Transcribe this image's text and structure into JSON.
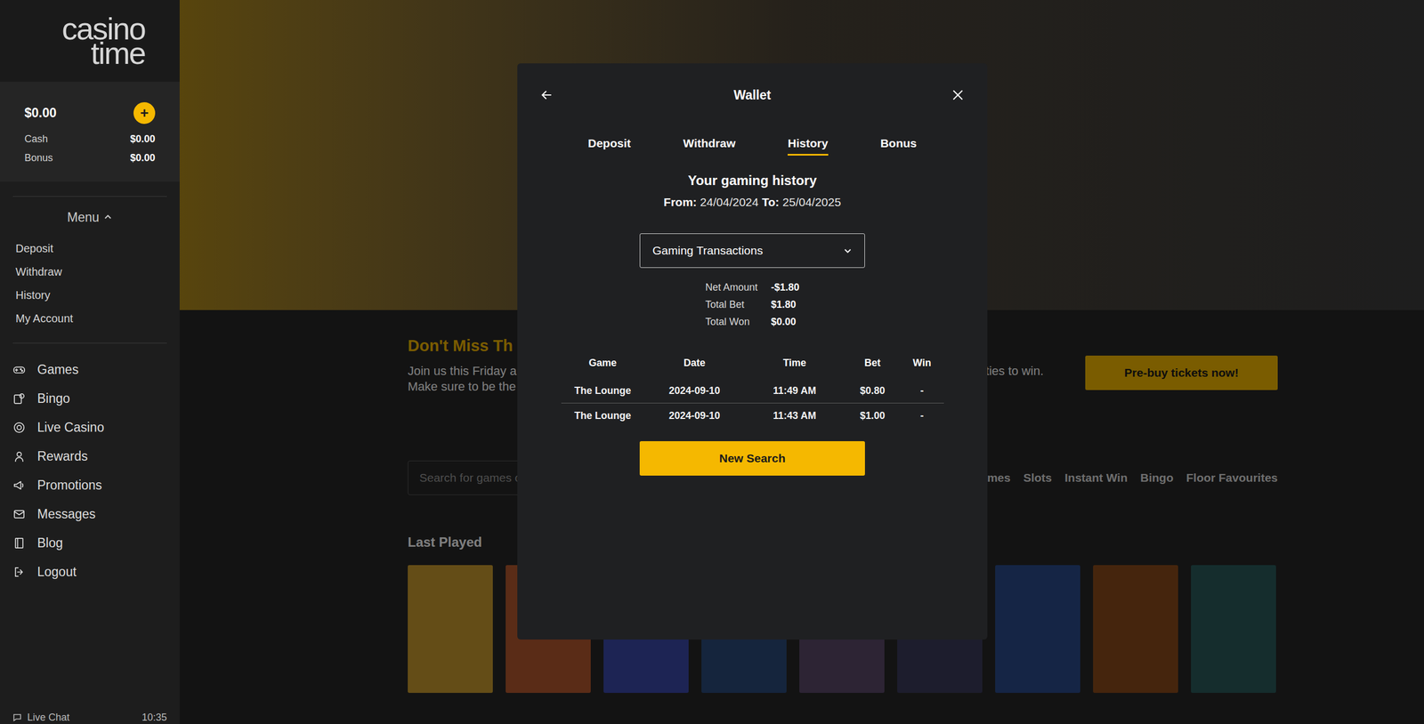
{
  "sidebar": {
    "logo": [
      "casino",
      "time"
    ],
    "balance": {
      "total": "$0.00",
      "add": "+",
      "cash_label": "Cash",
      "cash": "$0.00",
      "bonus_label": "Bonus",
      "bonus": "$0.00"
    },
    "menu": {
      "label": "Menu",
      "expanded": true,
      "items": [
        "Deposit",
        "Withdraw",
        "History",
        "My Account"
      ]
    },
    "nav": [
      "Games",
      "Bingo",
      "Live Casino",
      "Rewards",
      "Promotions",
      "Messages",
      "Blog",
      "Logout"
    ],
    "live_chat": {
      "label": "Live Chat",
      "time": "10:35"
    }
  },
  "page": {
    "promo": {
      "title": "Don't Miss Th",
      "lines": [
        "Join us this Friday a",
        "Make sure to be the"
      ],
      "tail": "ties to win.",
      "button": "Pre-buy tickets now!"
    },
    "search": {
      "placeholder": "Search for games or"
    },
    "categories": [
      "Games",
      "Slots",
      "Instant Win",
      "Bingo",
      "Floor Favourites"
    ],
    "last_played": {
      "title": "Last Played",
      "tiles": [
        {
          "color": "#c99a2e"
        },
        {
          "color": "#b5582e"
        },
        {
          "color": "#3a48a8"
        },
        {
          "color": "#2a4a7a"
        },
        {
          "color": "#5a4868"
        },
        {
          "color": "#3a3a5a"
        },
        {
          "color": "#2a4a8a"
        },
        {
          "color": "#8a4a1a"
        },
        {
          "color": "#2a5a5a"
        }
      ]
    }
  },
  "wallet": {
    "title": "Wallet",
    "tabs": [
      {
        "label": "Deposit",
        "selected": false
      },
      {
        "label": "Withdraw",
        "selected": false
      },
      {
        "label": "History",
        "selected": true
      },
      {
        "label": "Bonus",
        "selected": false
      }
    ],
    "heading": "Your gaming history",
    "range": {
      "from_label": "From:",
      "from": "24/04/2024",
      "to_label": "To:",
      "to": "25/04/2025"
    },
    "filter": {
      "value": "Gaming Transactions",
      "expanded": false
    },
    "summary": [
      {
        "label": "Net Amount",
        "value": "-$1.80"
      },
      {
        "label": "Total Bet",
        "value": "$1.80"
      },
      {
        "label": "Total Won",
        "value": "$0.00"
      }
    ],
    "table": {
      "columns": [
        "Game",
        "Date",
        "Time",
        "Bet",
        "Win"
      ],
      "rows": [
        [
          "The Lounge",
          "2024-09-10",
          "11:49 AM",
          "$0.80",
          "-"
        ],
        [
          "The Lounge",
          "2024-09-10",
          "11:43 AM",
          "$1.00",
          "-"
        ]
      ]
    },
    "button": "New Search"
  }
}
